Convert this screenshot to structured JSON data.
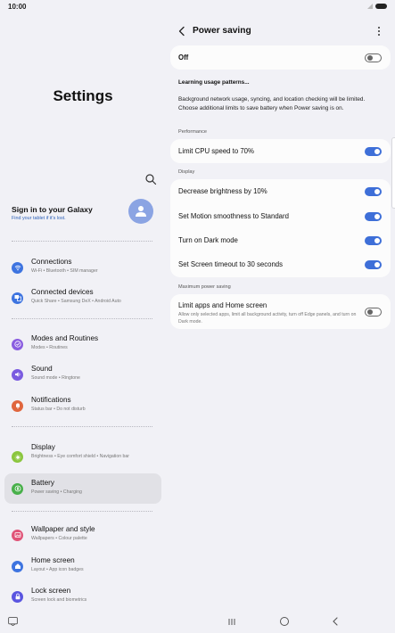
{
  "status": {
    "time": "10:00"
  },
  "left": {
    "title": "Settings",
    "account": {
      "title": "Sign in to your Galaxy",
      "subtitle": "Find your tablet if it's lost."
    },
    "menu": [
      {
        "label": "Connections",
        "sub": "Wi-Fi  •  Bluetooth  •  SIM manager",
        "icon": "wifi-icon",
        "color": "#3e74e0"
      },
      {
        "label": "Connected devices",
        "sub": "Quick Share  •  Samsung DeX  •  Android Auto",
        "icon": "connected-devices-icon",
        "color": "#3e74e0"
      },
      {
        "label": "Modes and Routines",
        "sub": "Modes  •  Routines",
        "icon": "check-circle-icon",
        "color": "#8a5de0"
      },
      {
        "label": "Sound",
        "sub": "Sound mode  •  Ringtone",
        "icon": "speaker-icon",
        "color": "#7a5be0"
      },
      {
        "label": "Notifications",
        "sub": "Status bar  •  Do not disturb",
        "icon": "bell-icon",
        "color": "#e0663e"
      },
      {
        "label": "Display",
        "sub": "Brightness  •  Eye comfort shield  •  Navigation bar",
        "icon": "sun-icon",
        "color": "#8bc63e"
      },
      {
        "label": "Battery",
        "sub": "Power saving  •  Charging",
        "icon": "battery-icon",
        "color": "#48b04a"
      },
      {
        "label": "Wallpaper and style",
        "sub": "Wallpapers  •  Colour palette",
        "icon": "wallpaper-icon",
        "color": "#e05478"
      },
      {
        "label": "Home screen",
        "sub": "Layout  •  App icon badges",
        "icon": "home-icon",
        "color": "#3e74e0"
      },
      {
        "label": "Lock screen",
        "sub": "Screen lock and biometrics",
        "icon": "lock-icon",
        "color": "#5a55e0"
      }
    ]
  },
  "right": {
    "title": "Power saving",
    "master": {
      "label": "Off",
      "on": false
    },
    "learning_title": "Learning usage patterns...",
    "learning_desc_1": "Background network usage, syncing, and location checking will be limited.",
    "learning_desc_2": "Choose additional limits to save battery when Power saving is on.",
    "sections": {
      "performance": "Performance",
      "display": "Display",
      "maximum": "Maximum power saving"
    },
    "performance_items": [
      {
        "label": "Limit CPU speed to 70%",
        "on": true
      }
    ],
    "display_items": [
      {
        "label": "Decrease brightness by 10%",
        "on": true
      },
      {
        "label": "Set Motion smoothness to Standard",
        "on": true
      },
      {
        "label": "Turn on Dark mode",
        "on": true
      },
      {
        "label": "Set Screen timeout to 30 seconds",
        "on": true
      }
    ],
    "maximum": {
      "label": "Limit apps and Home screen",
      "desc": "Allow only selected apps, limit all background activity, turn off Edge panels, and turn on Dark mode.",
      "on": false
    }
  },
  "colors": {
    "accent": "#3e6fd8",
    "background": "#f1f1f6",
    "card": "#fcfcfc"
  }
}
